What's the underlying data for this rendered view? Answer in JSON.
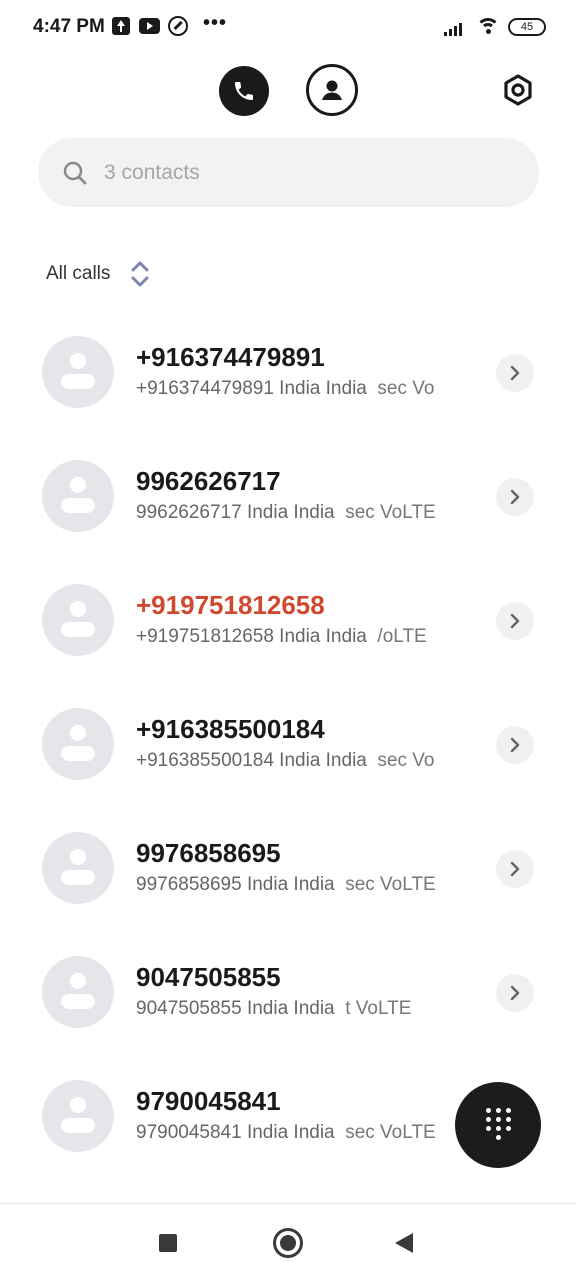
{
  "status_bar": {
    "time": "4:47 PM",
    "dots": "•••",
    "battery": "45",
    "icons": [
      "upload-icon",
      "youtube-icon",
      "data-saver-icon",
      "signal-icon",
      "wifi-icon",
      "battery-icon"
    ]
  },
  "tabs": {
    "active": "phone",
    "items": [
      {
        "name": "phone",
        "icon": "phone-icon"
      },
      {
        "name": "contacts",
        "icon": "person-icon"
      }
    ],
    "settings_icon": "settings-icon"
  },
  "search": {
    "placeholder": "3 contacts",
    "value": ""
  },
  "filter": {
    "label": "All calls"
  },
  "calls": [
    {
      "number": "+916374479891",
      "detail": "+916374479891 India India",
      "sim": "sec Vo",
      "missed": false
    },
    {
      "number": "9962626717",
      "detail": "9962626717 India India",
      "sim": "sec VoLTE",
      "missed": false
    },
    {
      "number": "+919751812658",
      "detail": "+919751812658 India India",
      "sim": "/oLTE",
      "missed": true
    },
    {
      "number": "+916385500184",
      "detail": "+916385500184 India India",
      "sim": "sec Vo",
      "missed": false
    },
    {
      "number": "9976858695",
      "detail": "9976858695 India India",
      "sim": "sec VoLTE",
      "missed": false
    },
    {
      "number": "9047505855",
      "detail": "9047505855 India India",
      "sim": "t VoLTE",
      "missed": false
    },
    {
      "number": "9790045841",
      "detail": "9790045841 India India",
      "sim": "sec VoLTE",
      "missed": false
    }
  ],
  "colors": {
    "missed": "#d0492f",
    "primary_text": "#1a1a1a",
    "secondary_text": "#666666",
    "avatar_bg": "#e4e6ea",
    "fab_bg": "#1c1c1c"
  }
}
